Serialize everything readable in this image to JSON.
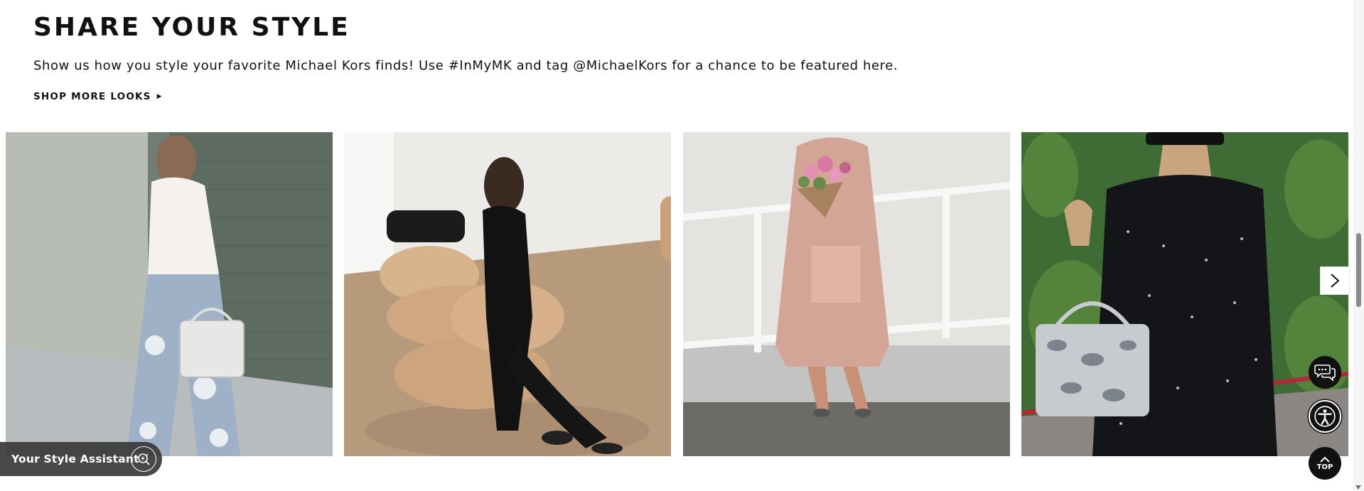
{
  "section": {
    "title": "SHARE YOUR STYLE",
    "description": "Show us how you style your favorite Michael Kors finds! Use #InMyMK and tag @MichaelKors for a chance to be featured here.",
    "shop_more_label": "SHOP MORE LOOKS",
    "shop_more_icon": "caret-right-icon"
  },
  "gallery": {
    "tiles": [
      {
        "icon": "look-photo-white-lace-top-floral-jeans"
      },
      {
        "icon": "look-photo-black-dress-tan-chair"
      },
      {
        "icon": "look-photo-pink-trench-flowers"
      },
      {
        "icon": "look-photo-black-lace-snakeskin-bag"
      }
    ],
    "next_icon": "chevron-right-icon"
  },
  "assistant": {
    "label": "Your Style Assistant",
    "icon": "ai-search-icon"
  },
  "floating_buttons": {
    "chat_icon": "chat-bubbles-icon",
    "accessibility_icon": "accessibility-icon",
    "top_label": "TOP"
  },
  "colors": {
    "text": "#111111",
    "background": "#ffffff",
    "assistant_bg": "#3a3a3a",
    "floating_btn": "#111111"
  }
}
